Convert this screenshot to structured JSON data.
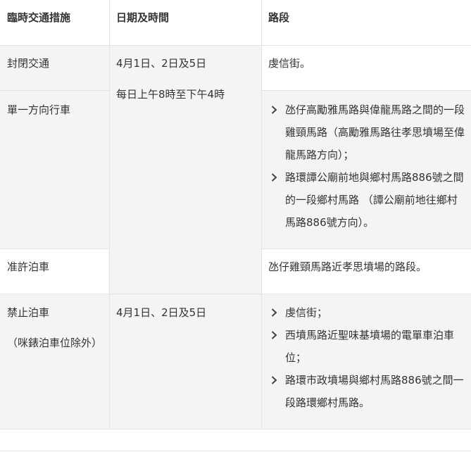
{
  "table": {
    "headers": [
      "臨時交通措施",
      "日期及時間",
      "路段"
    ],
    "rows": {
      "closure": {
        "measure": "封閉交通",
        "date": "4月1日、2日及5日",
        "time": "每日上午8時至下午4時",
        "section": "虔信街。"
      },
      "one_way": {
        "measure": "單一方向行車",
        "items": [
          "氹仔高勵雅馬路與偉龍馬路之間的一段雞頸馬路（高勵雅馬路往孝思墳場至偉龍馬路方向）；",
          "路環譚公廟前地與鄉村馬路886號之間的一段鄉村馬路 （譚公廟前地往鄉村馬路886號方向）。"
        ]
      },
      "parking_allowed": {
        "measure": "准許泊車",
        "section": "氹仔雞頸馬路近孝思墳場的路段。"
      },
      "no_parking": {
        "measure": "禁止泊車",
        "note": "（咪錶泊車位除外）",
        "date": "4月1日、2日及5日",
        "items": [
          "虔信街；",
          "西墳馬路近聖味基墳場的電單車泊車位；",
          "路環市政墳場與鄉村馬路886號之間一段路環鄉村馬路。"
        ]
      }
    }
  },
  "icons": {
    "bullet": "chevron-right-icon"
  },
  "colors": {
    "row_shade": "#f4f4f4",
    "border": "#e3e3e3",
    "text": "#333333"
  }
}
